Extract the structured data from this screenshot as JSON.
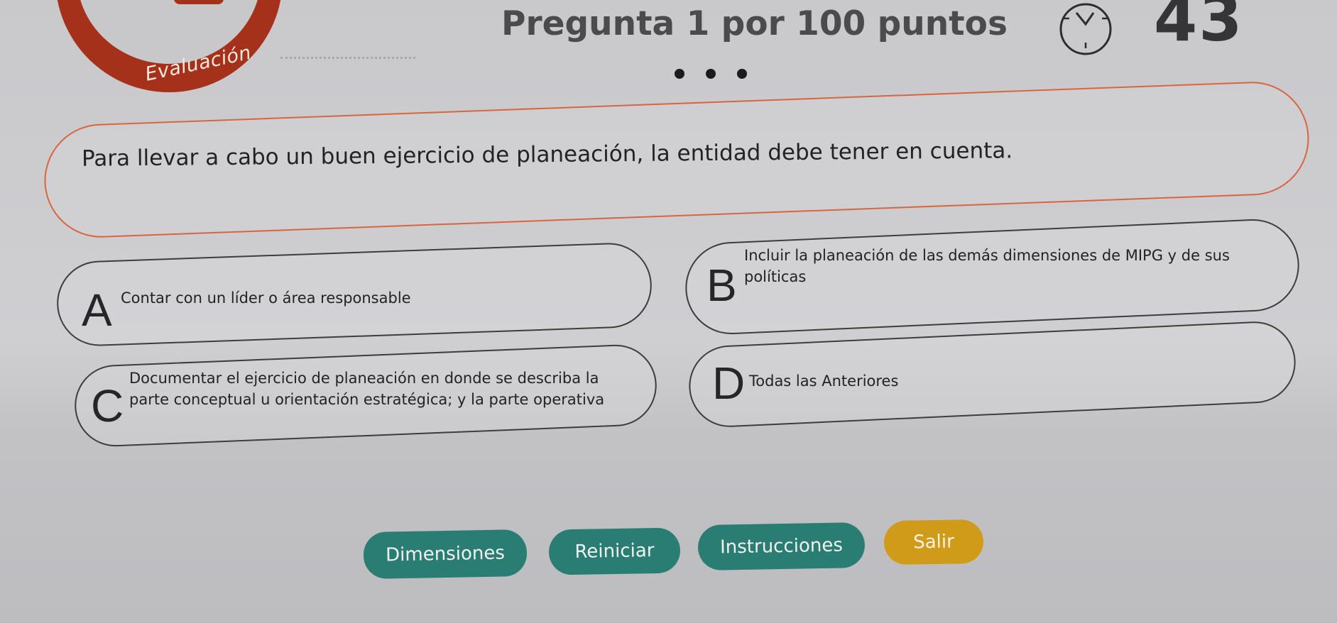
{
  "app": {
    "section_label": "Evaluación",
    "accent_color": "#a5311a",
    "question_border_color": "#d8663c"
  },
  "header": {
    "question_title": "Pregunta 1 por 100 puntos",
    "timer_value": "43",
    "timer_icon": "clock-icon"
  },
  "question": {
    "text": "Para llevar a cabo un buen ejercicio de planeación, la entidad debe tener en cuenta."
  },
  "options": [
    {
      "letter": "A",
      "text": "Contar con un líder o área responsable"
    },
    {
      "letter": "B",
      "text": "Incluir la planeación de las demás dimensiones de MIPG y de sus políticas"
    },
    {
      "letter": "C",
      "text": "Documentar el ejercicio de planeación en donde se describa la parte conceptual u orientación estratégica; y la parte operativa"
    },
    {
      "letter": "D",
      "text": "Todas las Anteriores"
    }
  ],
  "buttons": {
    "dimensiones": "Dimensiones",
    "reiniciar": "Reiniciar",
    "instrucciones": "Instrucciones",
    "salir": "Salir"
  },
  "colors": {
    "primary_button": "#2a7d73",
    "exit_button": "#cf9b18"
  }
}
